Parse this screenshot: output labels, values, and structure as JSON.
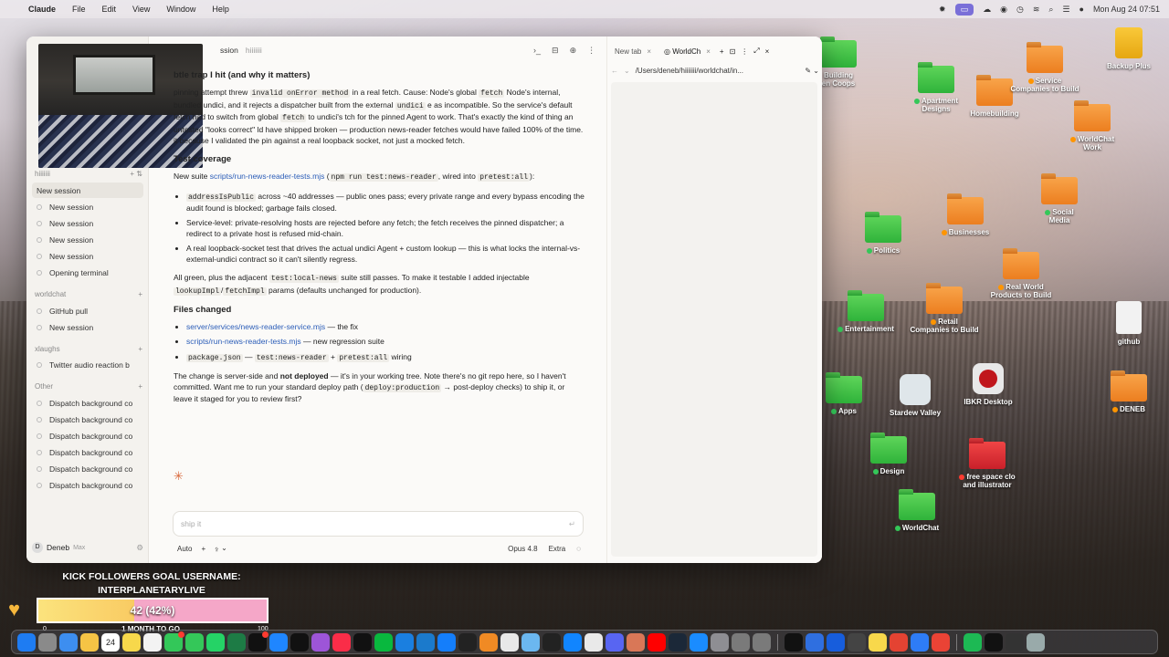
{
  "menubar": {
    "app_name": "Claude",
    "menus": [
      "File",
      "Edit",
      "View",
      "Window",
      "Help"
    ],
    "datetime": "Mon Aug 24  07:51"
  },
  "desktop_icons": [
    {
      "label": "Building\nen Coops",
      "color": "green",
      "tag": ""
    },
    {
      "label": "Apartment\nDesigns",
      "color": "green",
      "tag": "green"
    },
    {
      "label": "Homebuilding",
      "color": "orange",
      "tag": ""
    },
    {
      "label": "Service\nCompanies to Build",
      "color": "orange",
      "tag": "orange"
    },
    {
      "label": "Backup Plus",
      "color": "yellow",
      "tag": ""
    },
    {
      "label": "WorldChat\nWork",
      "color": "orange",
      "tag": "orange"
    },
    {
      "label": "Businesses",
      "color": "orange",
      "tag": "orange"
    },
    {
      "label": "Social\nMedia",
      "color": "orange",
      "tag": "green"
    },
    {
      "label": "Politics",
      "color": "green",
      "tag": "green"
    },
    {
      "label": "Real World\nProducts to Build",
      "color": "orange",
      "tag": "orange"
    },
    {
      "label": "Entertainment",
      "color": "green",
      "tag": "green"
    },
    {
      "label": "Retail\nCompanies to Build",
      "color": "orange",
      "tag": "orange"
    },
    {
      "label": "github",
      "color": "white",
      "tag": ""
    },
    {
      "label": "Apps",
      "color": "green",
      "tag": "green"
    },
    {
      "label": "Stardew Valley",
      "color": "app-sq",
      "tag": ""
    },
    {
      "label": "IBKR Desktop",
      "color": "ibkr",
      "tag": ""
    },
    {
      "label": "DENEB",
      "color": "orange",
      "tag": "orange"
    },
    {
      "label": "Design",
      "color": "green",
      "tag": "green"
    },
    {
      "label": "free space clo\nand illustrator",
      "color": "red",
      "tag": "red"
    },
    {
      "label": "WorldChat",
      "color": "green",
      "tag": "green"
    }
  ],
  "window": {
    "header_title": "ssion",
    "header_sub": "hiiiiiii"
  },
  "sidebar": {
    "top_head": "hiiiiiii",
    "items_a": [
      "New session",
      "New session",
      "New session",
      "New session",
      "New session",
      "Opening terminal"
    ],
    "group_worldchat": "worldchat",
    "items_b": [
      "GitHub pull",
      "New session"
    ],
    "group_xlaughs": "xlaughs",
    "items_c": [
      "Twitter audio reaction b"
    ],
    "group_other": "Other",
    "items_d": [
      "Dispatch background co",
      "Dispatch background co",
      "Dispatch background co",
      "Dispatch background co",
      "Dispatch background co",
      "Dispatch background co"
    ],
    "user": "Deneb",
    "plan": "Max",
    "avatar_letter": "D"
  },
  "chat": {
    "h_trap": "btle trap I hit (and why it matters)",
    "p_trap": {
      "t1": "pinning attempt threw ",
      "c1": "invalid onError method",
      "t2": " in a real fetch. Cause: Node's global ",
      "c2": "fetch",
      "t3": " Node's internal, bundled undici, and it rejects a dispatcher built from the external ",
      "c3": "undici",
      "t4": " e as incompatible. So the service's default fetch had to switch from global ",
      "c4": "fetch",
      "t5": " to undici's tch for the pinned Agent to work. That's exactly the kind of thing an untested \"looks correct\" ld have shipped broken — production news-reader fetches would have failed 100% of the time. it because I validated the pin against a real loopback socket, not just a mocked fetch."
    },
    "h_test": "Test coverage",
    "p_test": {
      "t1": "New suite ",
      "link": "scripts/run-news-reader-tests.mjs",
      "t2": " (",
      "c1": "npm run test:news-reader",
      "t3": ", wired into ",
      "c2": "pretest:all",
      "t4": "):"
    },
    "bullets_test": [
      {
        "code": "addressIsPublic",
        "text": " across ~40 addresses — public ones pass; every private range and every bypass encoding the audit found is blocked; garbage fails closed."
      },
      {
        "code": "",
        "text": "Service-level: private-resolving hosts are rejected before any fetch; the fetch receives the pinned dispatcher; a redirect to a private host is refused mid-chain."
      },
      {
        "code": "",
        "text": "A real loopback-socket test that drives the actual undici Agent + custom lookup — this is what locks the internal-vs-external-undici contract so it can't silently regress."
      }
    ],
    "p_green": {
      "t1": "All green, plus the adjacent ",
      "c1": "test:local-news",
      "t2": " suite still passes. To make it testable I added injectable ",
      "c2": "lookupImpl",
      "t3": "/",
      "c3": "fetchImpl",
      "t4": " params (defaults unchanged for production)."
    },
    "h_files": "Files changed",
    "files": [
      {
        "link": "server/services/news-reader-service.mjs",
        "text": " — the fix"
      },
      {
        "link": "scripts/run-news-reader-tests.mjs",
        "text": " — new regression suite"
      }
    ],
    "file_pkg": {
      "c1": "package.json",
      "t1": " — ",
      "c2": "test:news-reader",
      "t2": " + ",
      "c3": "pretest:all",
      "t3": " wiring"
    },
    "p_end": {
      "t1": "The change is server-side and ",
      "b1": "not deployed",
      "t2": " — it's in your working tree. Note there's no git repo here, so I haven't committed. Want me to run your standard deploy path (",
      "c1": "deploy:production",
      "t3": " → post-deploy checks) to ship it, or leave it staged for you to review first?"
    }
  },
  "composer": {
    "placeholder": "ship it",
    "mode": "Auto",
    "model": "Opus 4.8",
    "effort": "Extra"
  },
  "browser": {
    "tab1": "New tab",
    "tab2": "WorldCh",
    "url": "/Users/deneb/hiiiiiii/worldchat/in..."
  },
  "stream": {
    "goal_title": "KICK FOLLOWERS GOAL USERNAME:\nINTERPLANETARYLIVE",
    "goal_value": "42 (42%)",
    "goal_fraction": 0.42,
    "goal_min": "0",
    "goal_max": "100",
    "goal_period": "1 MONTH TO GO"
  },
  "dock": {
    "apps": [
      "finder-icon",
      "launchpad-icon",
      "mail-icon",
      "photos-icon",
      "calendar-icon",
      "notes-icon",
      "reminders-icon",
      "messages-icon",
      "facetime-icon",
      "whatsapp-icon",
      "excel-icon",
      "activity-icon",
      "safari-icon",
      "appletv-icon",
      "podcasts-icon",
      "music-icon",
      "tiktok-icon",
      "wechat-icon",
      "edge-icon",
      "vscode-icon",
      "xcode-icon",
      "terminal-icon",
      "pages-icon",
      "preview-icon",
      "folder-icon",
      "cursor-icon",
      "bluesky-icon",
      "chatgpt-icon",
      "discord-icon",
      "claude-icon",
      "youtube-icon",
      "steam-icon",
      "appstore-icon",
      "settings-icon",
      "help-icon",
      "help2-icon",
      "capcut-icon",
      "notability-icon",
      "bitwarden-icon",
      "unknown-icon",
      "notes2-icon",
      "todoist-icon",
      "finder2-icon",
      "chrome-icon",
      "spotify-icon",
      "chatgpt2-icon",
      "screen-icon",
      "trash-icon"
    ],
    "calendar_day": "24"
  }
}
